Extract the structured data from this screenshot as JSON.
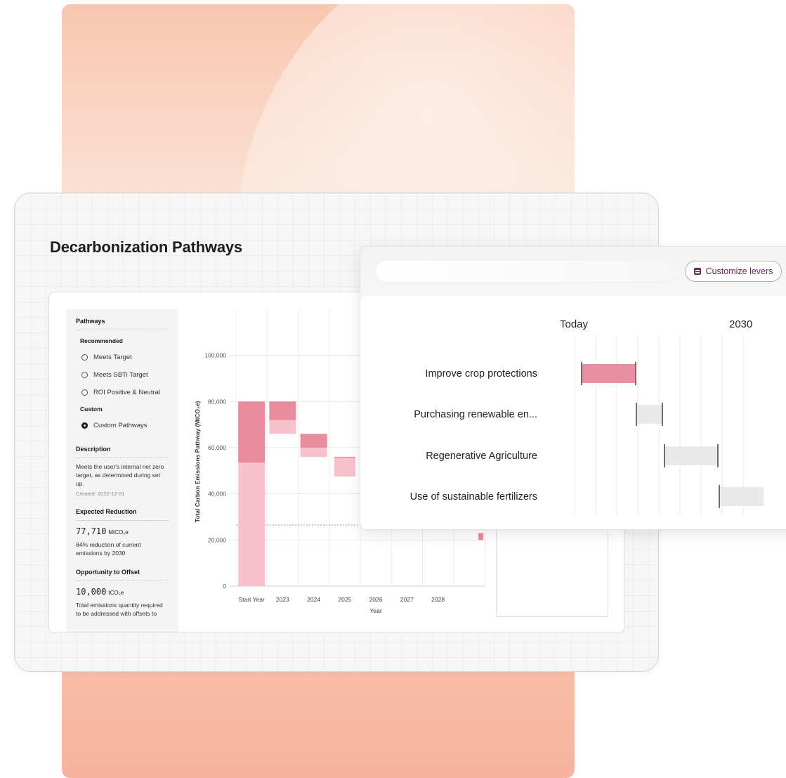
{
  "app": {
    "page_title": "Decarbonization Pathways"
  },
  "sidebar": {
    "pathways_heading": "Pathways",
    "recommended_label": "Recommended",
    "recommended_options": [
      "Meets Target",
      "Meets SBTi Target",
      "ROI Positive & Neutral"
    ],
    "custom_label": "Custom",
    "custom_option": "Custom Pathways",
    "selected_option": "Custom Pathways",
    "description_heading": "Description",
    "description_text": "Meets the user's internal net zero target, as determined during set up.",
    "created": "Created: 2022-12-01",
    "expected_heading": "Expected Reduction",
    "expected_value": "77,710",
    "expected_unit": "MtCO₂e",
    "expected_note": "84% reduction of current emissions by 2030",
    "offset_heading": "Opportunity to Offset",
    "offset_value": "10,000",
    "offset_unit": "tCO₂e",
    "offset_note": "Total emissions quantity required to be addressed with offsets to"
  },
  "chart_data": {
    "type": "bar",
    "subtype": "waterfall",
    "xlabel": "Year",
    "ylabel": "Total Carbon Emissions Pathway (MtCO₂e)",
    "categories": [
      "Start Year",
      "2023",
      "2024",
      "2025",
      "2026",
      "2027",
      "2028"
    ],
    "ylim": [
      0,
      120000
    ],
    "yticks": [
      0,
      20000,
      40000,
      60000,
      80000,
      100000
    ],
    "ytick_labels": [
      "0",
      "20,000",
      "40,000",
      "60,000",
      "80,000",
      "100,000"
    ],
    "target_line": 26500,
    "grid": true,
    "series": [
      {
        "values": [
          [
            0,
            53500
          ],
          [
            66000,
            72000
          ],
          [
            56000,
            60000
          ],
          [
            47500,
            55500
          ]
        ]
      },
      {
        "values": [
          [
            53500,
            80000
          ],
          [
            72000,
            80000
          ],
          [
            60000,
            66000
          ],
          [
            55500,
            56000
          ]
        ]
      }
    ],
    "colors": {
      "dark": "#e88c9e",
      "light": "#f8c2cd",
      "target": "#c8c8c8"
    },
    "hidden_by_overlay": [
      "2026",
      "2027"
    ],
    "bar_2028": [
      20000,
      23000
    ]
  },
  "popup": {
    "customize_label": "Customize levers",
    "today_label": "Today",
    "end_label": "2030",
    "levers": [
      {
        "name": "Improve crop protections",
        "state": "active"
      },
      {
        "name": "Purchasing renewable en...",
        "state": "inactive"
      },
      {
        "name": "Regenerative Agriculture",
        "state": "inactive"
      },
      {
        "name": "Use of sustainable fertilizers",
        "state": "inactive"
      }
    ],
    "colors": {
      "active": "#e98da0",
      "inactive": "#e9e9e9",
      "edge": "#6f6f6f"
    }
  }
}
